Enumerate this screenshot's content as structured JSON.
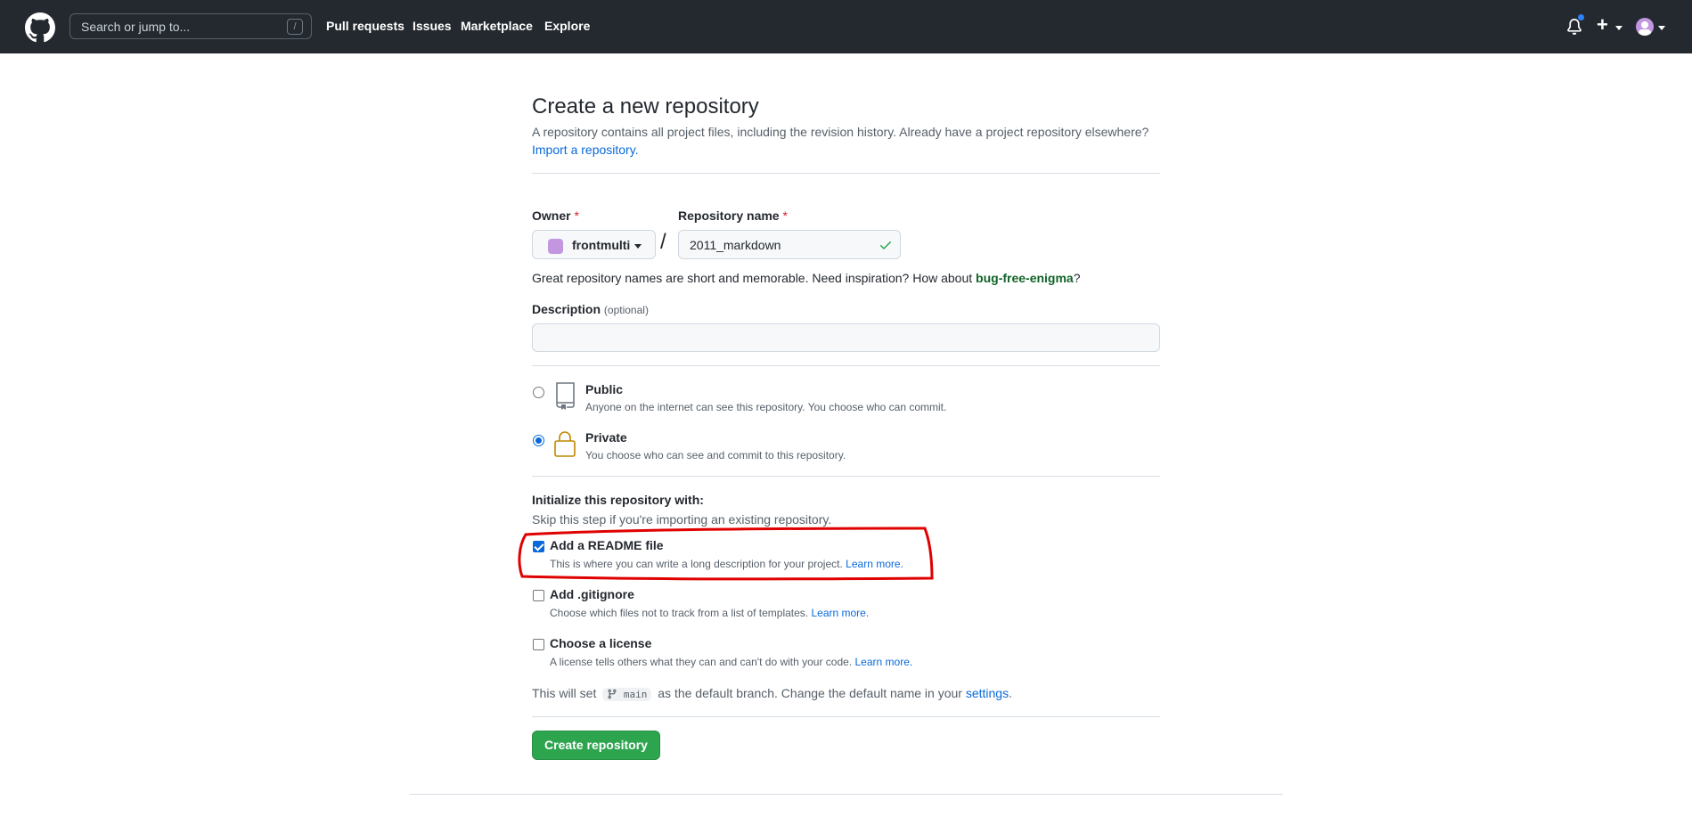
{
  "header": {
    "search_placeholder": "Search or jump to...",
    "search_shortcut": "/",
    "nav": [
      "Pull requests",
      "Issues",
      "Marketplace",
      "Explore"
    ],
    "icons": [
      "github-logo-icon",
      "bell-icon",
      "plus-icon",
      "avatar"
    ]
  },
  "page": {
    "title": "Create a new repository",
    "subtitle": "A repository contains all project files, including the revision history. Already have a project repository elsewhere?",
    "import_link": "Import a repository."
  },
  "form": {
    "owner_label": "Owner",
    "owner_value": "frontmulti",
    "required_mark": "*",
    "repo_label": "Repository name",
    "repo_value": "2011_markdown",
    "separator": "/",
    "hint_prefix": "Great repository names are short and memorable. Need inspiration? How about",
    "hint_suggestion": "bug-free-enigma",
    "hint_suffix": "?",
    "description_label": "Description",
    "description_optional": "(optional)",
    "description_value": ""
  },
  "visibility": {
    "public_title": "Public",
    "public_desc": "Anyone on the internet can see this repository. You choose who can commit.",
    "private_title": "Private",
    "private_desc": "You choose who can see and commit to this repository.",
    "selected": "Private"
  },
  "init": {
    "title": "Initialize this repository with:",
    "subtitle": "Skip this step if you're importing an existing repository.",
    "readme_title": "Add a README file",
    "readme_desc": "This is where you can write a long description for your project.",
    "readme_checked": true,
    "gitignore_title": "Add .gitignore",
    "gitignore_desc": "Choose which files not to track from a list of templates.",
    "gitignore_checked": false,
    "license_title": "Choose a license",
    "license_desc": "A license tells others what they can and can't do with your code.",
    "license_checked": false,
    "learn_more": "Learn more."
  },
  "branch": {
    "prefix": "This will set",
    "branch_name": "main",
    "middle": "as the default branch. Change the default name in your",
    "settings_link": "settings",
    "suffix": "."
  },
  "submit_label": "Create repository",
  "colors": {
    "header_bg": "#24292f",
    "primary_button": "#2da44e",
    "link": "#0969da",
    "annotation": "#e00000"
  }
}
